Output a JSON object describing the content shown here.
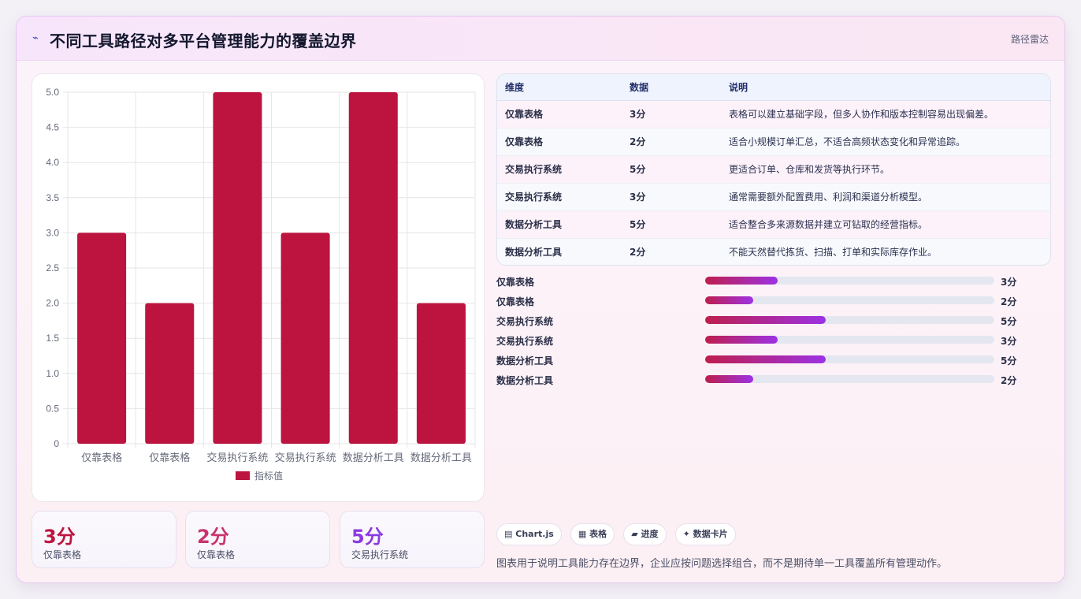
{
  "header": {
    "icon": "pulse-icon",
    "title": "不同工具路径对多平台管理能力的覆盖边界",
    "tag": "路径雷达"
  },
  "chart_data": {
    "type": "bar",
    "categories": [
      "仅靠表格",
      "仅靠表格",
      "交易执行系统",
      "交易执行系统",
      "数据分析工具",
      "数据分析工具"
    ],
    "series": [
      {
        "name": "指标值",
        "values": [
          3,
          2,
          5,
          3,
          5,
          2
        ],
        "color": "#bc143e"
      }
    ],
    "ylim": [
      0,
      5
    ],
    "y_ticks": [
      "0",
      "0.5",
      "1.0",
      "1.5",
      "2.0",
      "2.5",
      "3.0",
      "3.5",
      "4.0",
      "4.5",
      "5.0"
    ],
    "grid": true,
    "legend": "bottom",
    "title": "",
    "xlabel": "",
    "ylabel": ""
  },
  "stats": [
    {
      "value": "3分",
      "label": "仅靠表格",
      "color": "#bc143e"
    },
    {
      "value": "2分",
      "label": "仅靠表格",
      "color": "#c8336e"
    },
    {
      "value": "5分",
      "label": "交易执行系统",
      "color": "#8a3be0"
    }
  ],
  "table": {
    "headers": [
      "维度",
      "数据",
      "说明"
    ],
    "rows": [
      {
        "dim": "仅靠表格",
        "score": "3分",
        "desc": "表格可以建立基础字段，但多人协作和版本控制容易出现偏差。"
      },
      {
        "dim": "仅靠表格",
        "score": "2分",
        "desc": "适合小规模订单汇总，不适合高频状态变化和异常追踪。"
      },
      {
        "dim": "交易执行系统",
        "score": "5分",
        "desc": "更适合订单、仓库和发货等执行环节。"
      },
      {
        "dim": "交易执行系统",
        "score": "3分",
        "desc": "通常需要额外配置费用、利润和渠道分析模型。"
      },
      {
        "dim": "数据分析工具",
        "score": "5分",
        "desc": "适合整合多来源数据并建立可钻取的经营指标。"
      },
      {
        "dim": "数据分析工具",
        "score": "2分",
        "desc": "不能天然替代拣货、扫描、打单和实际库存作业。"
      }
    ]
  },
  "progress": [
    {
      "label": "仅靠表格",
      "value": "3分",
      "fraction": 0.25
    },
    {
      "label": "仅靠表格",
      "value": "2分",
      "fraction": 0.167
    },
    {
      "label": "交易执行系统",
      "value": "5分",
      "fraction": 0.417
    },
    {
      "label": "交易执行系统",
      "value": "3分",
      "fraction": 0.25
    },
    {
      "label": "数据分析工具",
      "value": "5分",
      "fraction": 0.417
    },
    {
      "label": "数据分析工具",
      "value": "2分",
      "fraction": 0.167
    }
  ],
  "chips": [
    {
      "icon": "bar-chart-icon",
      "glyph": "▤",
      "label": "Chart.js"
    },
    {
      "icon": "table-icon",
      "glyph": "▦",
      "label": "表格"
    },
    {
      "icon": "progress-icon",
      "glyph": "▰",
      "label": "进度"
    },
    {
      "icon": "sparkle-icon",
      "glyph": "✦",
      "label": "数据卡片"
    }
  ],
  "footnote": "图表用于说明工具能力存在边界，企业应按问题选择组合，而不是期待单一工具覆盖所有管理动作。"
}
